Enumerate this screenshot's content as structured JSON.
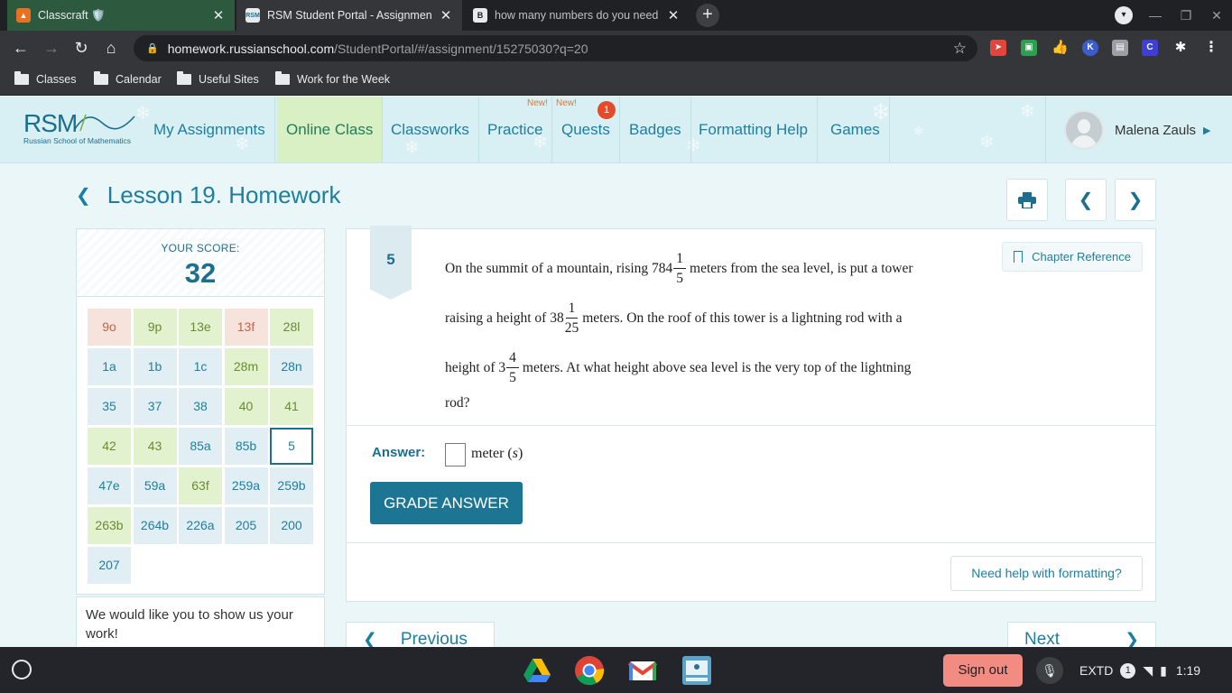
{
  "browser": {
    "tabs": [
      {
        "title": "Classcraft 🛡️",
        "favicon": "classcraft-icon",
        "active": false
      },
      {
        "title": "RSM Student Portal - Assignment",
        "favicon": "rsm-icon",
        "active": true
      },
      {
        "title": "how many numbers do you need",
        "favicon": "b-icon",
        "active": false
      }
    ],
    "url_host": "homework.russianschool.com",
    "url_path": "/StudentPortal/#/assignment/15275030?q=20",
    "bookmarks": [
      "Classes",
      "Calendar",
      "Useful Sites",
      "Work for the Week"
    ]
  },
  "site": {
    "logo_text": "RSM",
    "logo_sub": "Russian School of Mathematics",
    "nav": [
      {
        "label": "My Assignments"
      },
      {
        "label": "Online Class"
      },
      {
        "label": "Classworks"
      },
      {
        "label": "Practice",
        "tag": "New!"
      },
      {
        "label": "Quests",
        "tag": "New!",
        "badge": "1"
      },
      {
        "label": "Badges"
      },
      {
        "label": "Formatting Help"
      },
      {
        "label": "Games"
      }
    ],
    "user_name": "Malena Zauls"
  },
  "lesson": {
    "title": "Lesson 19. Homework",
    "score_label": "YOUR SCORE:",
    "score": "32",
    "problems": [
      {
        "label": "9o",
        "status": "red"
      },
      {
        "label": "9p",
        "status": "green"
      },
      {
        "label": "13e",
        "status": "green"
      },
      {
        "label": "13f",
        "status": "red"
      },
      {
        "label": "28l",
        "status": "green"
      },
      {
        "label": "1a",
        "status": "blue"
      },
      {
        "label": "1b",
        "status": "blue"
      },
      {
        "label": "1c",
        "status": "blue"
      },
      {
        "label": "28m",
        "status": "green"
      },
      {
        "label": "28n",
        "status": "blue"
      },
      {
        "label": "35",
        "status": "blue"
      },
      {
        "label": "37",
        "status": "blue"
      },
      {
        "label": "38",
        "status": "blue"
      },
      {
        "label": "40",
        "status": "green"
      },
      {
        "label": "41",
        "status": "green"
      },
      {
        "label": "42",
        "status": "green"
      },
      {
        "label": "43",
        "status": "green"
      },
      {
        "label": "85a",
        "status": "blue"
      },
      {
        "label": "85b",
        "status": "blue"
      },
      {
        "label": "5",
        "status": "current"
      },
      {
        "label": "47e",
        "status": "blue"
      },
      {
        "label": "59a",
        "status": "blue"
      },
      {
        "label": "63f",
        "status": "green"
      },
      {
        "label": "259a",
        "status": "blue"
      },
      {
        "label": "259b",
        "status": "blue"
      },
      {
        "label": "263b",
        "status": "green"
      },
      {
        "label": "264b",
        "status": "blue"
      },
      {
        "label": "226a",
        "status": "blue"
      },
      {
        "label": "205",
        "status": "blue"
      },
      {
        "label": "200",
        "status": "blue"
      },
      {
        "label": "207",
        "status": "blue"
      }
    ],
    "work_note": "We would like you to show us your work!"
  },
  "question": {
    "number": "5",
    "chapter_ref": "Chapter Reference",
    "line1_a": "On the summit of a mountain, rising 784",
    "frac1_n": "1",
    "frac1_d": "5",
    "line1_b": "meters from the sea level, is put a tower",
    "line2_a": "raising a height of 38",
    "frac2_n": "1",
    "frac2_d": "25",
    "line2_b": "meters. On the roof of this tower is a lightning rod with a",
    "line3_a": "height of 3",
    "frac3_n": "4",
    "frac3_d": "5",
    "line3_b": "meters. At what height above sea level is the very top of the lightning",
    "line4": "rod?",
    "answer_label": "Answer:",
    "answer_value": "",
    "unit_text": "meter (",
    "unit_var": "s",
    "unit_close": ")",
    "grade_button": "GRADE ANSWER",
    "help_button": "Need help with formatting?",
    "prev_label": "Previous",
    "next_label": "Next"
  },
  "shelf": {
    "sign_out": "Sign out",
    "keyboard": "EXTD",
    "notif_count": "1",
    "time": "1:19"
  },
  "colors": {
    "accent": "#1d7f9f",
    "selected_nav": "#d8f0c4",
    "grade_button": "#1d7594"
  }
}
